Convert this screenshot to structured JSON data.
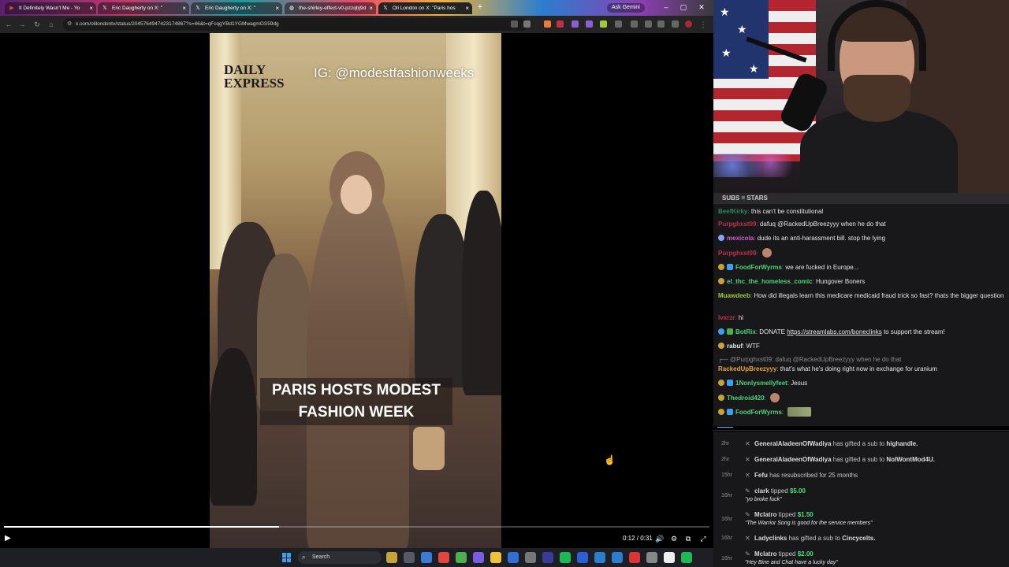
{
  "browser": {
    "tabs": [
      {
        "label": "It Definitely Wasn't Me - Yo",
        "icon_color": "#ff3d3d"
      },
      {
        "label": "Eric Daugherty on X: \"",
        "icon_color": "#ffffff"
      },
      {
        "label": "Eric Daugherty on X: \"",
        "icon_color": "#ffffff"
      },
      {
        "label": "the-shirley-effect-v0-pzzqbj9d",
        "icon_color": "#ffffff"
      },
      {
        "label": "Oli London on X: \"Paris hos",
        "icon_color": "#ffffff"
      }
    ],
    "new_tab_glyph": "+",
    "ask_gemini": "Ask Gemini",
    "url": "x.com/olilondontv/status/2045764947423174867?s=46&t=qFcqgYBd1YGMwagmOS59dg",
    "window_controls": [
      "–",
      "▢",
      "✕"
    ]
  },
  "video": {
    "logo_text": "DAILY EXPRESS",
    "ig_handle": "IG: @modestfashionweeks",
    "caption": "PARIS HOSTS MODEST FASHION WEEK",
    "time": "0:12 / 0:31",
    "progress": 0.39,
    "play_glyph": "▶",
    "controls": [
      "🔊",
      "⚙",
      "⧉",
      "⤢"
    ]
  },
  "taskbar": {
    "search_label": "Search",
    "search_glyph": "⌕",
    "icon_colors": [
      "#c9a23a",
      "#555a66",
      "#3a7bd5",
      "#e2453c",
      "#4caf50",
      "#7b5be0",
      "#f0c23a",
      "#2f6fd6",
      "#777",
      "#3a3a9a",
      "#1db954",
      "#2b5fd6",
      "#2b7ecf",
      "#2b7ecf",
      "#d33",
      "#888",
      "#eee",
      "#1db954"
    ]
  },
  "chat": {
    "header": "SUBS = STARS",
    "messages": [
      {
        "user": "BeefKirky",
        "color": "#2e8b57",
        "text": "this can't be constitutional",
        "badges": []
      },
      {
        "user": "Purpghxst09",
        "color": "#c0304a",
        "text": "dafuq @RackedUpBreezyyy when he do that",
        "badges": []
      },
      {
        "user": "mexicola",
        "color": "#d65bd6",
        "text": "dude its an anti-harassment bill. stop the lying",
        "badges": [
          "#8aa0ff"
        ]
      },
      {
        "user": "Purpghxst09",
        "color": "#c0304a",
        "text": "",
        "badges": [],
        "emote": true
      },
      {
        "user": "FoodForWyrms",
        "color": "#4dd17a",
        "text": "we are fucked in Europe...",
        "badges": [
          "#c9a23a",
          "#3aa0f0"
        ]
      },
      {
        "user": "el_thc_the_homeless_comic",
        "color": "#4dd17a",
        "text": "Hungover Boners",
        "badges": [
          "#c9a23a"
        ]
      },
      {
        "user": "Muawdeeb",
        "color": "#9acd32",
        "text": "How did illegals learn this medicare medicaid fraud trick so fast? thats the bigger question",
        "badges": []
      },
      {
        "user": "lvxrzr",
        "color": "#c0304a",
        "text": "hi",
        "badges": []
      },
      {
        "user": "BotRix",
        "color": "#4dd17a",
        "text": "DONATE",
        "link": "https://streamlabs.com/boneclinks",
        "text_after": "to support the stream!",
        "badges": [
          "#3aa0f0",
          "#4caf50"
        ]
      },
      {
        "user": "rabuf",
        "color": "#e6e6e6",
        "text": "WTF",
        "badges": [
          "#c9a23a"
        ]
      },
      {
        "reply": "@Purpghxst09: dafuq @RackedUpBreezyyy when he do that"
      },
      {
        "user": "RackedUpBreezyyy",
        "color": "#e8a23a",
        "text": "that's what he's doing right now in exchange for uranium",
        "badges": []
      },
      {
        "user": "1Nonlysmellyfeet",
        "color": "#4dd17a",
        "text": "Jesus",
        "badges": [
          "#c9a23a",
          "#3aa0f0"
        ]
      },
      {
        "user": "Thedroid420",
        "color": "#4dd17a",
        "text": "",
        "badges": [
          "#c9a23a"
        ],
        "emote": true
      },
      {
        "user": "FoodForWyrms",
        "color": "#4dd17a",
        "text": "",
        "badges": [
          "#c9a23a",
          "#3aa0f0"
        ],
        "emote_wide": true
      }
    ]
  },
  "events": [
    {
      "time": "2hr",
      "icon": "✕",
      "user": "GeneralAladeenOfWadiya",
      "text": "has gifted a sub to",
      "target": "highandle."
    },
    {
      "time": "2hr",
      "icon": "✕",
      "user": "GeneralAladeenOfWadiya",
      "text": "has gifted a sub to",
      "target": "NoIWontMod4U."
    },
    {
      "time": "15hr",
      "icon": "✕",
      "user": "Fefu",
      "text": "has resubscribed for 25 months",
      "target": ""
    },
    {
      "time": "16hr",
      "icon": "✎",
      "user": "clark",
      "text": "tipped",
      "amount": "$5.00",
      "quote": "\"yo broke fuck\""
    },
    {
      "time": "16hr",
      "icon": "✎",
      "user": "Mclatro",
      "text": "tipped",
      "amount": "$1.50",
      "quote": "\"The Warrior Song is good for the service members\""
    },
    {
      "time": "16hr",
      "icon": "✕",
      "user": "Ladyclinks",
      "text": "has gifted a sub to",
      "target": "Cincycelts."
    },
    {
      "time": "16hr",
      "icon": "✎",
      "user": "Mclatro",
      "text": "tipped",
      "amount": "$2.00",
      "quote": "\"Hey Bine and Chat have a lucky day\""
    }
  ]
}
